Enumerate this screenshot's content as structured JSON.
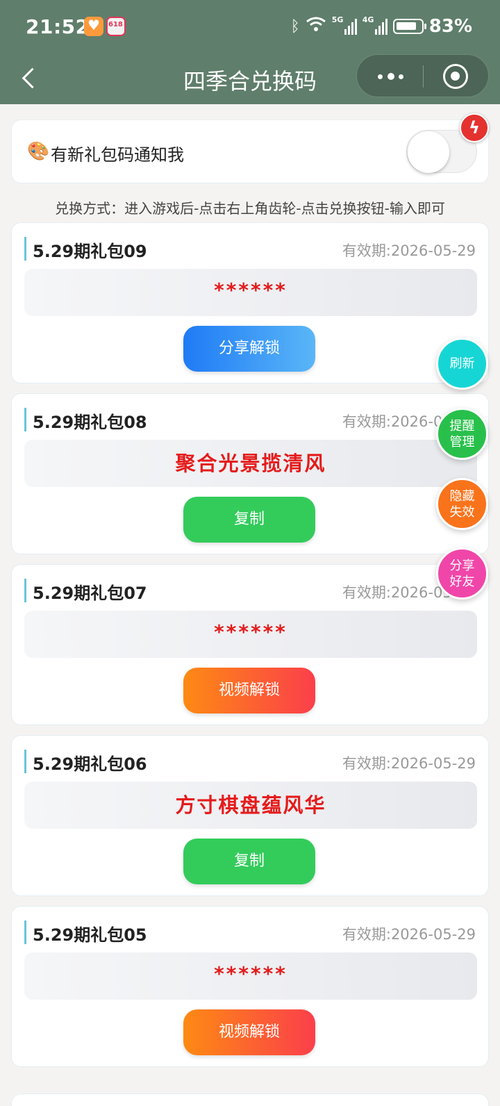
{
  "status_bar": {
    "time": "21:52",
    "signal1_label": "5G",
    "signal2_label": "4G",
    "battery_pct": "83%",
    "battery_level": 0.83
  },
  "nav": {
    "title": "四季合兑换码"
  },
  "notify": {
    "icon": "palette-icon",
    "label": "有新礼包码通知我",
    "toggle_on": false
  },
  "instruction": "兑换方式：进入游戏后-点击右上角齿轮-点击兑换按钮-输入即可",
  "gifts": [
    {
      "title": "5.29期礼包09",
      "expiry": "有效期:2026-05-29",
      "code": "******",
      "button": "分享解锁"
    },
    {
      "title": "5.29期礼包08",
      "expiry": "有效期:2026-05-29",
      "code": "聚合光景揽清风",
      "button": "复制"
    },
    {
      "title": "5.29期礼包07",
      "expiry": "有效期:2026-05-29",
      "code": "******",
      "button": "视频解锁"
    },
    {
      "title": "5.29期礼包06",
      "expiry": "有效期:2026-05-29",
      "code": "方寸棋盘蕴风华",
      "button": "复制"
    },
    {
      "title": "5.29期礼包05",
      "expiry": "有效期:2026-05-29",
      "code": "******",
      "button": "视频解锁"
    }
  ],
  "floating": {
    "refresh": "刷新",
    "remind_line1": "提醒",
    "remind_line2": "管理",
    "hide_line1": "隐藏",
    "hide_line2": "失效",
    "share_line1": "分享",
    "share_line2": "好友"
  },
  "colors": {
    "header_green": "#5f7e6b",
    "code_red": "#e51b1b",
    "copy_green": "#33cc5b",
    "share_blue": "#1f7bf5",
    "video_orange": "#fd8a13"
  }
}
